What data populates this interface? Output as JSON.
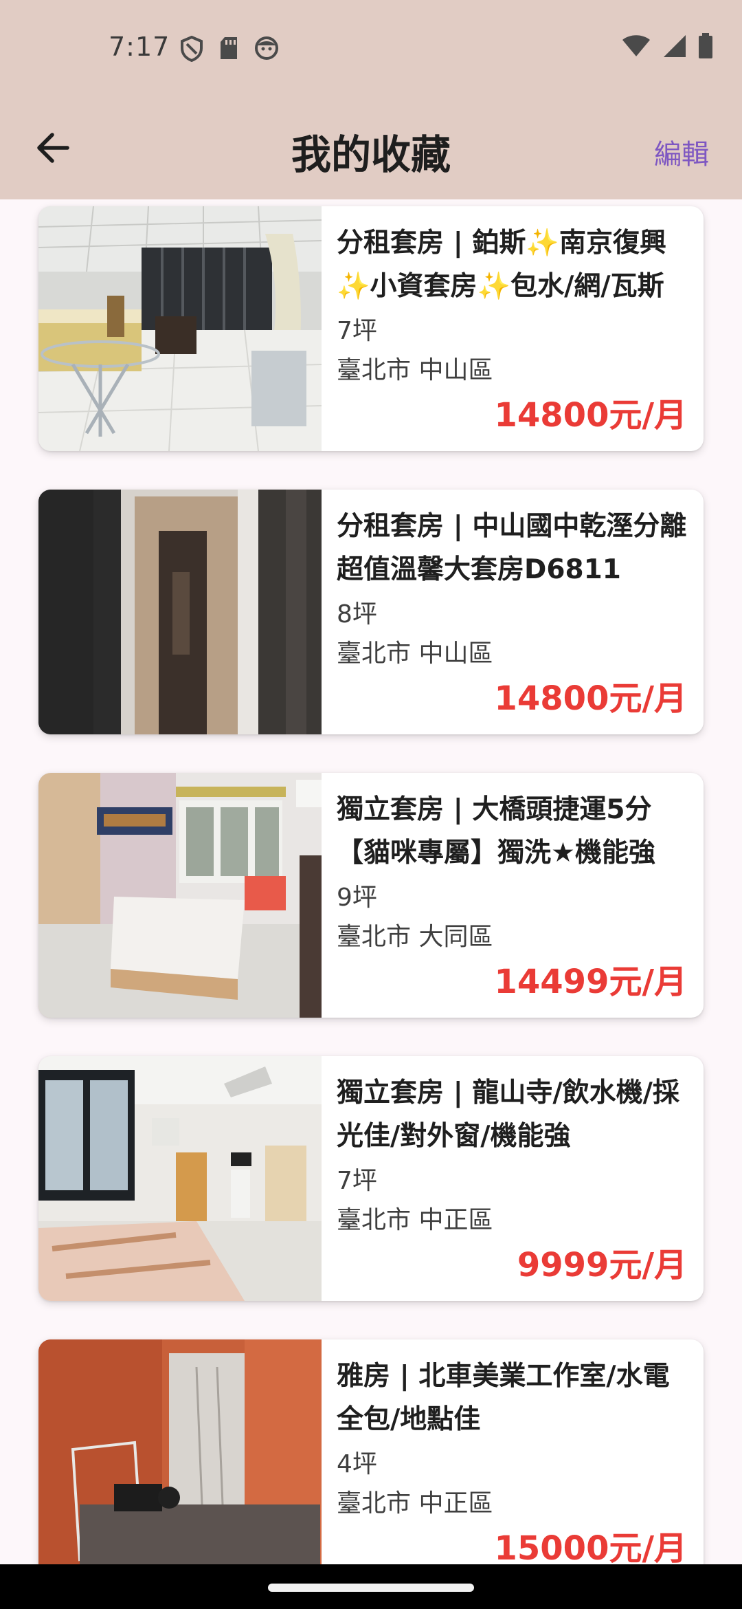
{
  "status_bar": {
    "time": "7:17",
    "icons": [
      "shield-icon",
      "sd-card-icon",
      "face-icon",
      "wifi-icon",
      "signal-icon",
      "battery-icon"
    ]
  },
  "app_bar": {
    "title": "我的收藏",
    "edit_label": "編輯",
    "back_icon": "arrow-left-icon"
  },
  "colors": {
    "header_bg": "#e1ccc4",
    "accent": "#7e57c2",
    "price": "#ea3b36",
    "background": "#fdf7fa"
  },
  "listings": [
    {
      "title": "分租套房 | 鉑斯✨南京復興✨小資套房✨包水/網/瓦斯",
      "size": "7坪",
      "location": "臺北市 中山區",
      "price": "14800元/月"
    },
    {
      "title": "分租套房 | 中山國中乾溼分離超值溫馨大套房D6811",
      "size": "8坪",
      "location": "臺北市 中山區",
      "price": "14800元/月"
    },
    {
      "title": "獨立套房 | 大橋頭捷運5分【貓咪專屬】獨洗★機能強",
      "size": "9坪",
      "location": "臺北市 大同區",
      "price": "14499元/月"
    },
    {
      "title": "獨立套房 | 龍山寺/飲水機/採光佳/對外窗/機能強",
      "size": "7坪",
      "location": "臺北市 中正區",
      "price": "9999元/月"
    },
    {
      "title": "雅房 | 北車美業工作室/水電全包/地點佳",
      "size": "4坪",
      "location": "臺北市 中正區",
      "price": "15000元/月"
    }
  ]
}
